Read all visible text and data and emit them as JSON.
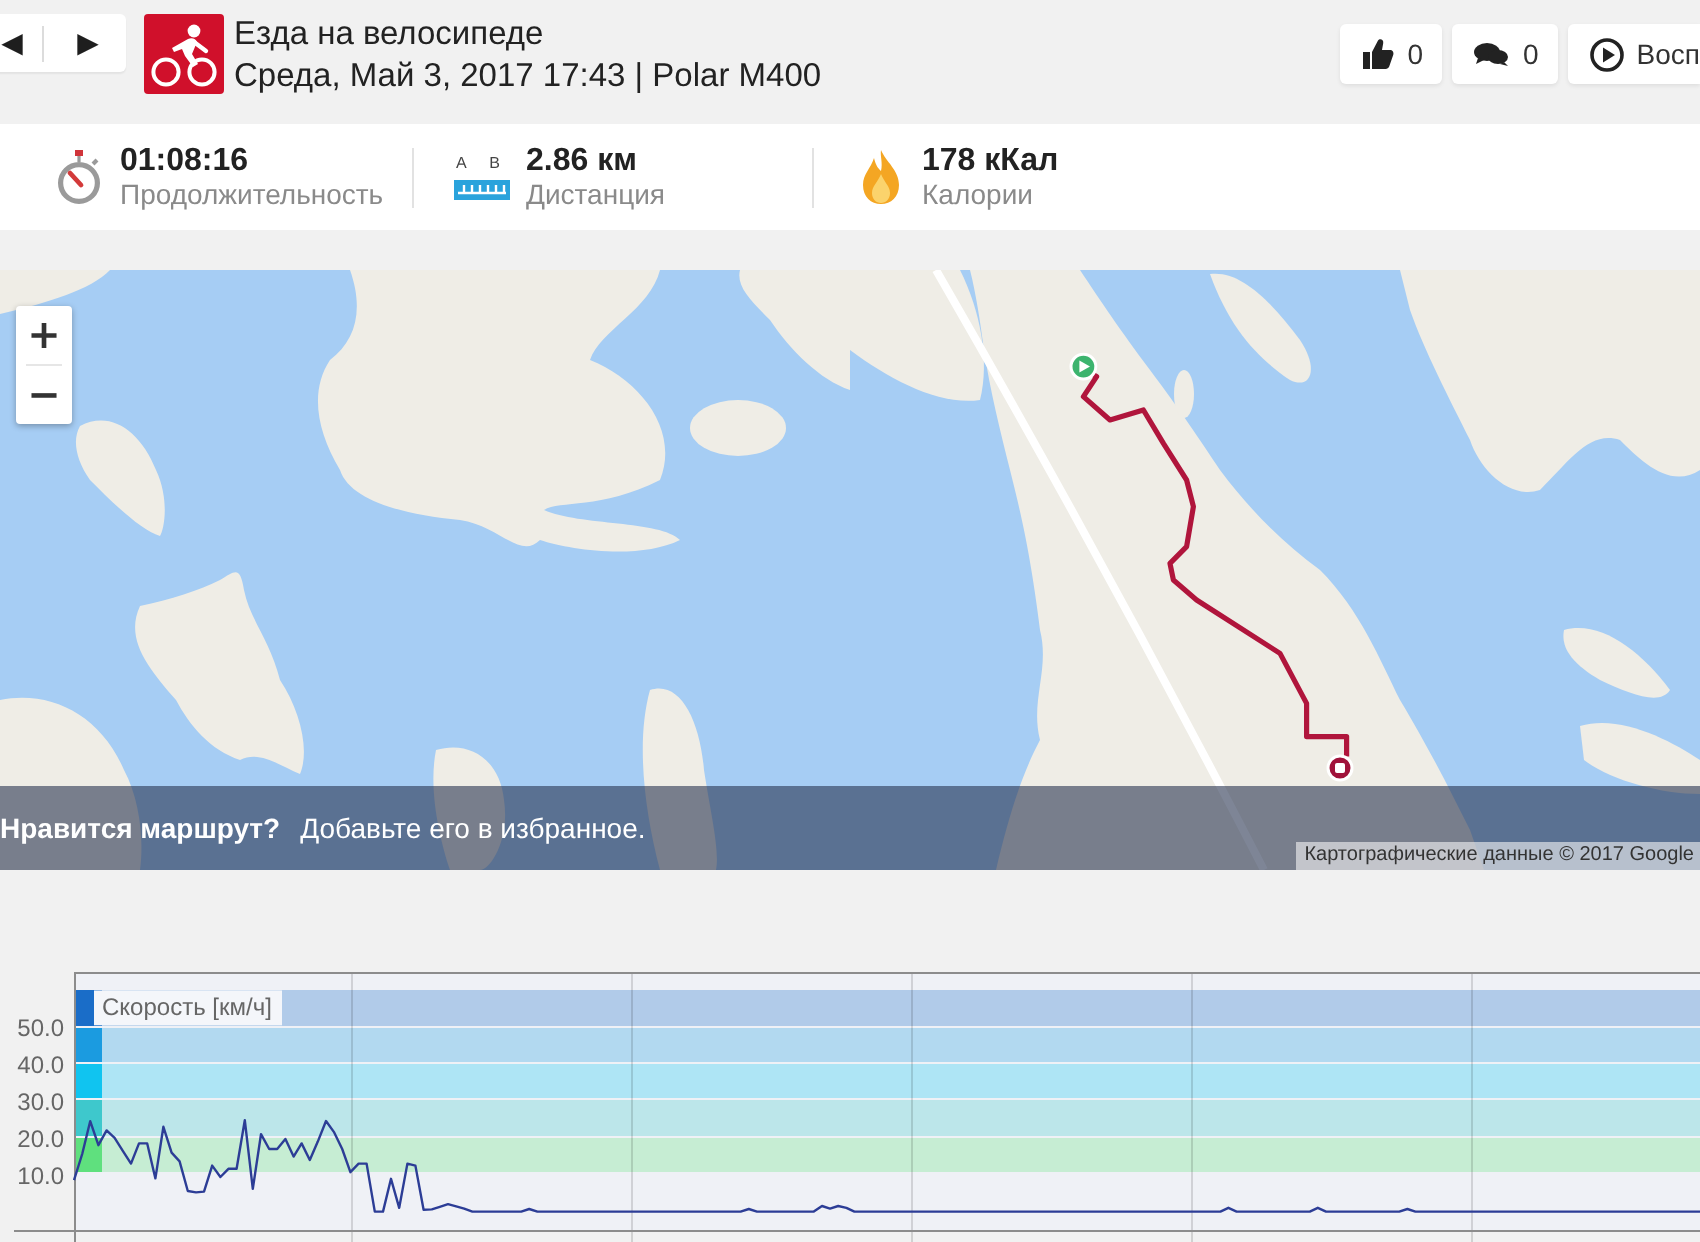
{
  "nav": {
    "buttons": [
      "◀",
      "▶"
    ]
  },
  "activity": {
    "kind": "cycling",
    "title": "Езда на велосипеде",
    "subtitle": "Среда, Май 3, 2017 17:43 | Polar M400"
  },
  "actions": [
    {
      "kind": "like",
      "label": "0"
    },
    {
      "kind": "comment",
      "label": "0"
    },
    {
      "kind": "replay",
      "label": "Восп"
    }
  ],
  "stats": [
    {
      "kind": "duration",
      "value": "01:08:16",
      "label": "Продолжительность"
    },
    {
      "kind": "distance",
      "value": "2.86 км",
      "label": "Дистанция",
      "points": [
        "A",
        "B"
      ]
    },
    {
      "kind": "calories",
      "value": "178 кКал",
      "label": "Калории"
    }
  ],
  "map": {
    "zoom_buttons": [
      "+",
      "−"
    ],
    "banner": {
      "question": "Нравится маршрут?",
      "hint": "Добавьте его в избранное."
    },
    "attribution": "Картографические данные © 2017 Google"
  },
  "speed_chart": {
    "zones": [
      {
        "color": "#1a6dc8"
      },
      {
        "color": "#1b9be0"
      },
      {
        "color": "#10c4f0"
      },
      {
        "color": "#3ec8cc"
      },
      {
        "color": "#5fe07e"
      }
    ],
    "chart_data": {
      "type": "line",
      "ylim": [
        -5,
        65
      ],
      "yticks": [
        {
          "value": 10,
          "label": "10.0"
        },
        {
          "value": 20,
          "label": "20.0"
        },
        {
          "value": 30,
          "label": "30.0"
        },
        {
          "value": 40,
          "label": "40.0"
        },
        {
          "value": 50,
          "label": "50.0"
        }
      ],
      "series": [
        {
          "name": "Скорость [км/ч]",
          "color": "#2c3d96",
          "values": [
            8.5,
            15.6,
            24.5,
            18,
            22,
            20,
            16.5,
            13,
            18.5,
            18.5,
            9,
            23,
            16,
            13.6,
            5.6,
            5.2,
            5.4,
            12.5,
            9.4,
            11.6,
            11.6,
            24.8,
            6.2,
            21,
            17,
            17,
            19.7,
            14.9,
            18.5,
            14,
            19,
            24.6,
            21.5,
            17,
            10.7,
            13,
            13,
            0,
            0,
            8.9,
            1,
            13,
            12.5,
            0.5,
            0.6,
            1.3,
            2,
            1.4,
            0.8,
            0,
            0,
            0,
            0,
            0,
            0,
            0,
            0.7,
            0,
            0,
            0,
            0,
            0,
            0,
            0,
            0,
            0,
            0,
            0,
            0,
            0,
            0,
            0,
            0,
            0,
            0,
            0,
            0,
            0,
            0,
            0,
            0,
            0,
            0,
            0.7,
            0,
            0,
            0,
            0,
            0,
            0,
            0,
            0,
            1.5,
            0.8,
            1.5,
            1,
            0,
            0,
            0,
            0,
            0,
            0,
            0,
            0,
            0,
            0,
            0,
            0,
            0,
            0,
            0,
            0,
            0,
            0,
            0,
            0,
            0,
            0,
            0,
            0,
            0,
            0,
            0,
            0,
            0,
            0,
            0,
            0,
            0,
            0,
            0,
            0,
            0,
            0,
            0,
            0,
            0,
            0,
            0,
            0,
            0,
            0,
            1,
            0,
            0,
            0,
            0,
            0,
            0,
            0,
            0,
            0,
            0,
            1,
            0,
            0,
            0,
            0,
            0,
            0,
            0,
            0,
            0,
            0,
            0.7,
            0,
            0,
            0,
            0,
            0,
            0,
            0,
            0,
            0,
            0,
            0,
            0,
            0,
            0,
            0,
            0,
            0,
            0,
            0,
            0,
            0,
            0,
            0,
            0,
            0,
            0,
            0,
            0,
            0,
            0,
            0,
            0,
            0,
            0,
            0,
            0
          ]
        }
      ]
    }
  }
}
